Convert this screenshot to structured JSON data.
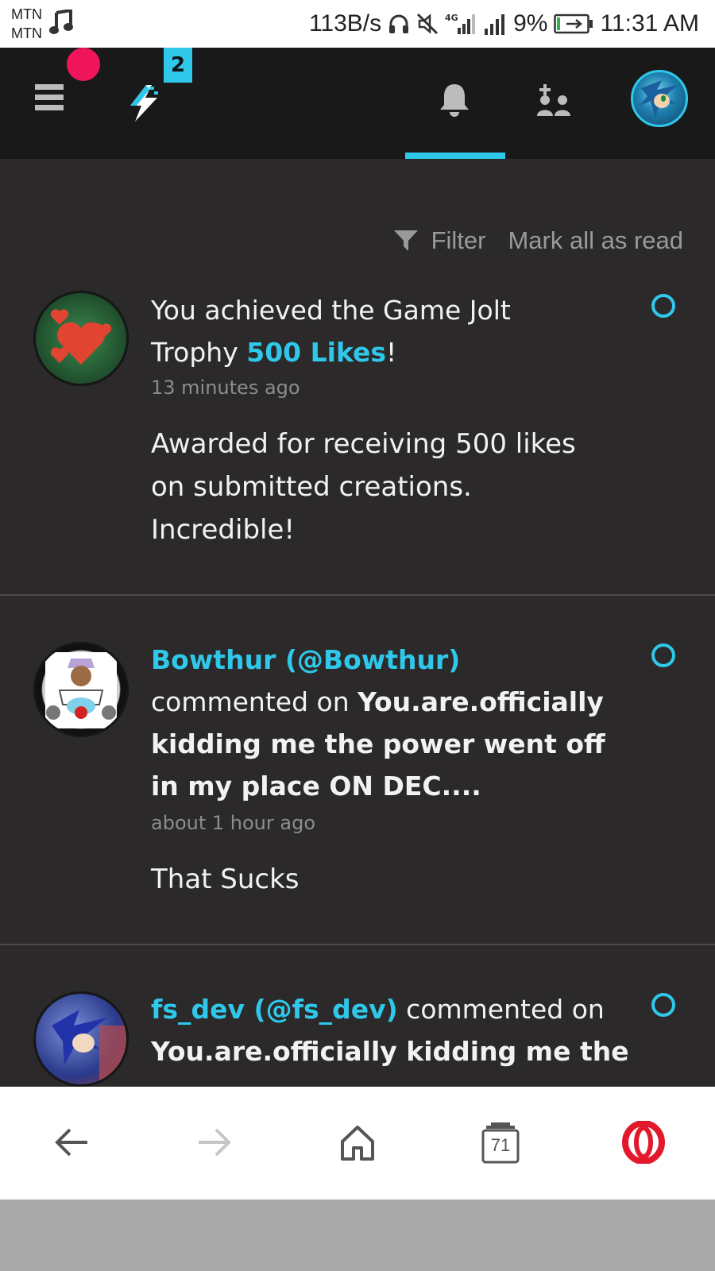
{
  "status_bar": {
    "carrier_1": "MTN",
    "carrier_2": "MTN",
    "speed": "113B/s",
    "network": "4G",
    "battery": "9%",
    "time": "11:31 AM"
  },
  "top_bar": {
    "activity_badge_count": "2",
    "active_tab": "notifications"
  },
  "filter_row": {
    "filter_label": "Filter",
    "mark_read_label": "Mark all as read"
  },
  "notifications": [
    {
      "line1": "You achieved the Game Jolt",
      "line2_prefix": "Trophy ",
      "trophy": "500 Likes",
      "line2_suffix": "!",
      "time": "13 minutes ago",
      "body_1": "Awarded for receiving 500 likes",
      "body_2": "on submitted creations.",
      "body_3": "Incredible!"
    },
    {
      "user": "Bowthur (@Bowthur)",
      "action": "commented on ",
      "post_1": "You.are.officially",
      "post_2": "kidding me the power went off",
      "post_3": "in my place ON DEC....",
      "time": "about 1 hour ago",
      "body": "That Sucks"
    },
    {
      "user": "fs_dev (@fs_dev)",
      "action": " commented on",
      "post_1": "You.are.officially kidding me the"
    }
  ],
  "browser_bar": {
    "tabs_count": "71"
  },
  "colors": {
    "accent": "#2fc8ea",
    "background": "#2b2929",
    "topbar": "#191919",
    "alert_dot": "#f0155a",
    "opera_red": "#e2192b"
  }
}
